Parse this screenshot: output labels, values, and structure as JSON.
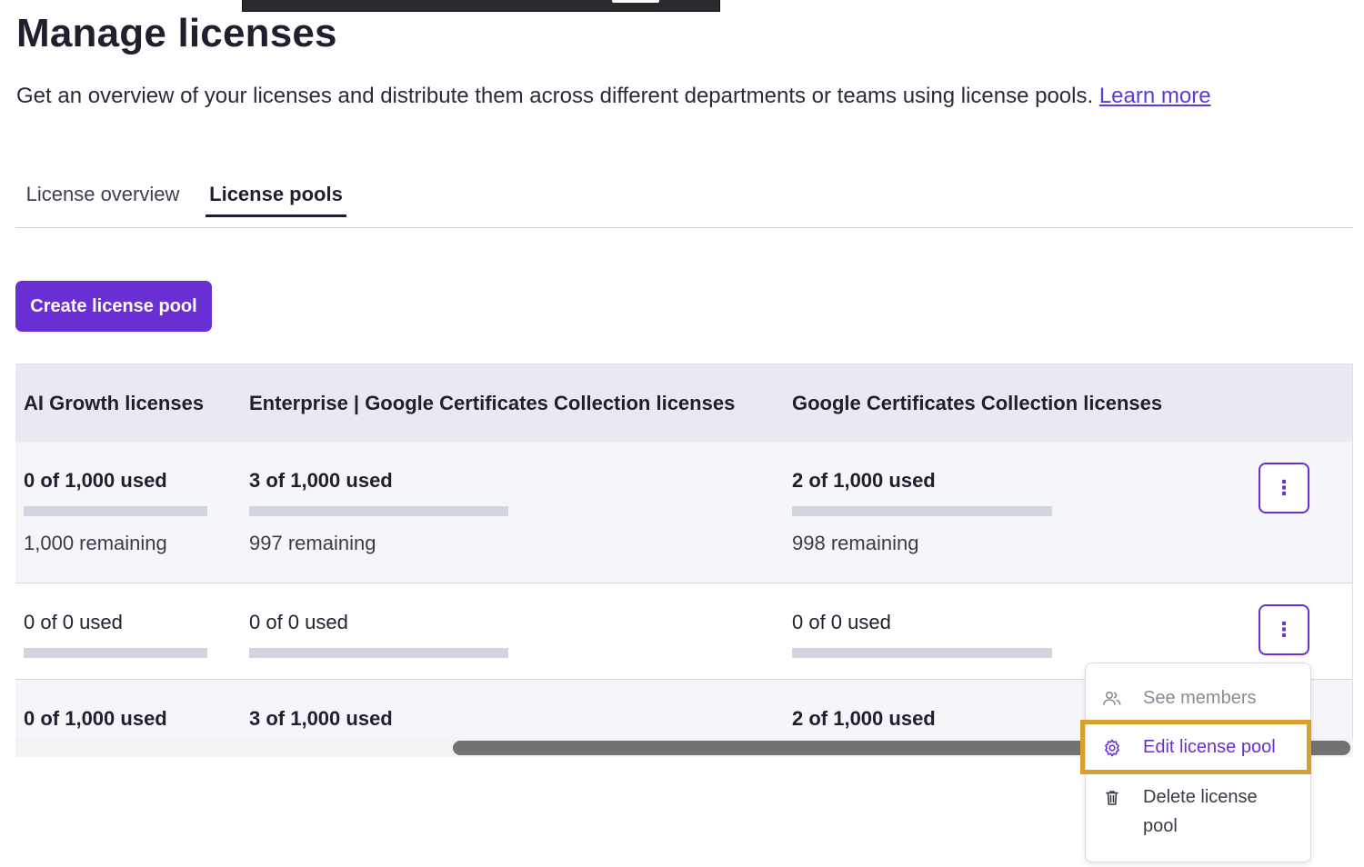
{
  "page": {
    "title": "Manage licenses",
    "subtitle": "Get an overview of your licenses and distribute them across different departments or teams using license pools.",
    "learn_more": "Learn more"
  },
  "tabs": [
    {
      "label": "License overview",
      "active": false
    },
    {
      "label": "License pools",
      "active": true
    }
  ],
  "create_button": "Create license pool",
  "table": {
    "columns": [
      "AI Growth licenses",
      "Enterprise | Google Certificates Collection licenses",
      "Google Certificates Collection licenses"
    ],
    "rows": [
      {
        "cells": [
          {
            "used": "0 of 1,000 used",
            "remaining": "1,000 remaining"
          },
          {
            "used": "3 of 1,000 used",
            "remaining": "997 remaining"
          },
          {
            "used": "2 of 1,000 used",
            "remaining": "998 remaining"
          }
        ],
        "usage_fraction": [
          0.0,
          0.003,
          0.002
        ]
      },
      {
        "cells": [
          {
            "used": "0 of 0 used"
          },
          {
            "used": "0 of 0 used"
          },
          {
            "used": "0 of 0 used"
          }
        ],
        "usage_fraction": [
          0,
          0,
          0
        ]
      },
      {
        "cells": [
          {
            "used": "0 of 1,000 used"
          },
          {
            "used": "3 of 1,000 used"
          },
          {
            "used": "2 of 1,000 used"
          }
        ]
      }
    ]
  },
  "kebab_glyph": "⋮",
  "menu": {
    "items": [
      {
        "label": "See members",
        "icon": "people-icon",
        "disabled": true
      },
      {
        "label": "Edit license pool",
        "icon": "gear-icon",
        "highlighted": true
      },
      {
        "label": "Delete license pool",
        "icon": "trash-icon"
      }
    ]
  },
  "colors": {
    "accent": "#6a2fd4",
    "highlight_outline": "#d9a030",
    "header_bg": "#e9eaf1",
    "bar": "#d3d4e1"
  }
}
